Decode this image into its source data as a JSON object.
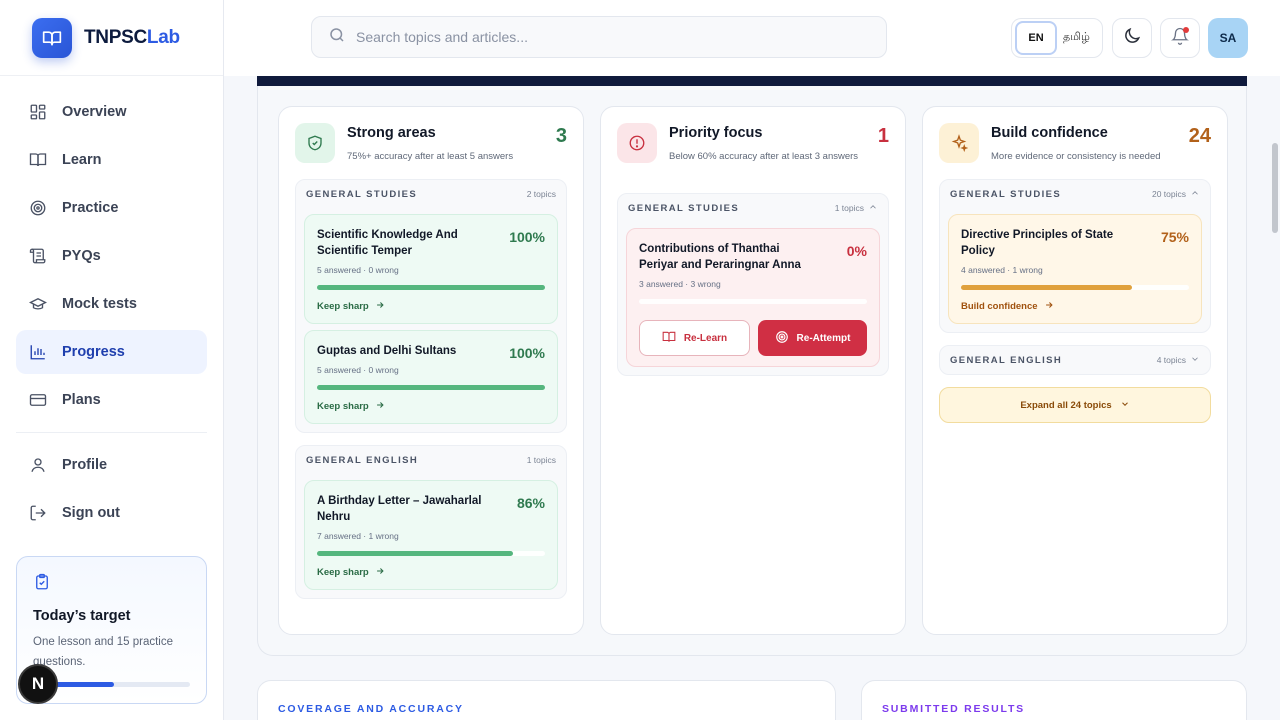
{
  "brand": {
    "name_main": "TNPSC",
    "name_accent": "Lab"
  },
  "nav": {
    "items": [
      {
        "label": "Overview"
      },
      {
        "label": "Learn"
      },
      {
        "label": "Practice"
      },
      {
        "label": "PYQs"
      },
      {
        "label": "Mock tests"
      },
      {
        "label": "Progress"
      },
      {
        "label": "Plans"
      }
    ],
    "profile": "Profile",
    "signout": "Sign out",
    "active": "Progress"
  },
  "target": {
    "title": "Today’s target",
    "subtitle": "One lesson and 15 practice questions.",
    "progress": 0.5
  },
  "dev_badge": "N",
  "topbar": {
    "search_placeholder": "Search topics and articles...",
    "lang_en": "EN",
    "lang_ta": "தமிழ்",
    "avatar": "SA"
  },
  "colors": {
    "accent": "#2d5be3",
    "green": "#2f7a4f",
    "red": "#c8303f",
    "amber": "#b2611a"
  },
  "strong": {
    "title": "Strong areas",
    "subtitle": "75%+ accuracy after at least 5 answers",
    "count": "3",
    "groups": [
      {
        "name": "GENERAL STUDIES",
        "count": "2 topics",
        "topics": [
          {
            "title": "Scientific Knowledge And Scientific Temper",
            "pct": "100%",
            "meta": "5 answered · 0 wrong",
            "link": "Keep sharp",
            "progress": 1.0
          },
          {
            "title": "Guptas and Delhi Sultans",
            "pct": "100%",
            "meta": "5 answered · 0 wrong",
            "link": "Keep sharp",
            "progress": 1.0
          }
        ]
      },
      {
        "name": "GENERAL ENGLISH",
        "count": "1 topics",
        "topics": [
          {
            "title": "A Birthday Letter – Jawaharlal Nehru",
            "pct": "86%",
            "meta": "7 answered · 1 wrong",
            "link": "Keep sharp",
            "progress": 0.86
          }
        ]
      }
    ]
  },
  "priority": {
    "title": "Priority focus",
    "subtitle": "Below 60% accuracy after at least 3 answers",
    "count": "1",
    "groups": [
      {
        "name": "GENERAL STUDIES",
        "count": "1 topics",
        "topics": [
          {
            "title": "Contributions of Thanthai Periyar and Peraringnar Anna",
            "pct": "0%",
            "meta": "3 answered · 3 wrong",
            "progress": 0.0,
            "relearn": "Re-Learn",
            "reattempt": "Re-Attempt"
          }
        ]
      }
    ]
  },
  "confidence": {
    "title": "Build confidence",
    "subtitle": "More evidence or consistency is needed",
    "count": "24",
    "groups": [
      {
        "name": "GENERAL STUDIES",
        "count": "20 topics",
        "topics": [
          {
            "title": "Directive Principles of State Policy",
            "pct": "75%",
            "meta": "4 answered · 1 wrong",
            "link": "Build confidence",
            "progress": 0.75
          }
        ]
      },
      {
        "name": "GENERAL ENGLISH",
        "count": "4 topics"
      }
    ],
    "expand": "Expand all 24 topics"
  },
  "bottom": {
    "coverage": "COVERAGE AND ACCURACY",
    "submitted": "SUBMITTED RESULTS"
  }
}
